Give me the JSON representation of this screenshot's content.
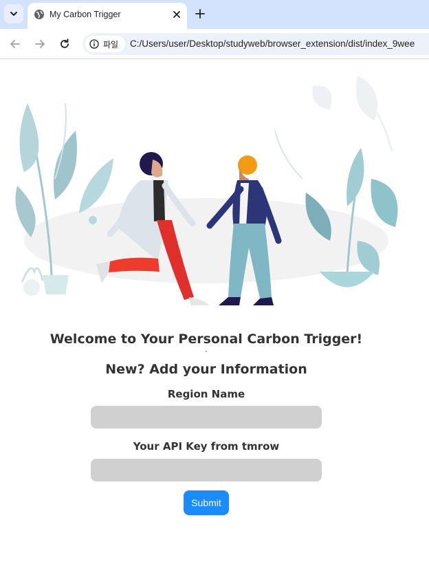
{
  "browser": {
    "tab_title": "My Carbon Trigger",
    "security_chip_label": "파일",
    "url": "C:/Users/user/Desktop/studyweb/browser_extension/dist/index_9wee"
  },
  "page": {
    "welcome_heading": "Welcome to Your Personal Carbon Trigger!",
    "stray_mark": "`",
    "new_heading": "New? Add your Information",
    "region_label": "Region Name",
    "region_value": "",
    "api_label": "Your API Key from tmrow",
    "api_value": "",
    "submit_label": "Submit"
  },
  "colors": {
    "tabbar": "#d3e3fd",
    "input_bg": "#d0d0d0",
    "button": "#1a8cff"
  },
  "icons": [
    "tab-search-icon",
    "globe-icon",
    "close-icon",
    "plus-icon",
    "back-icon",
    "forward-icon",
    "reload-icon",
    "info-icon"
  ]
}
